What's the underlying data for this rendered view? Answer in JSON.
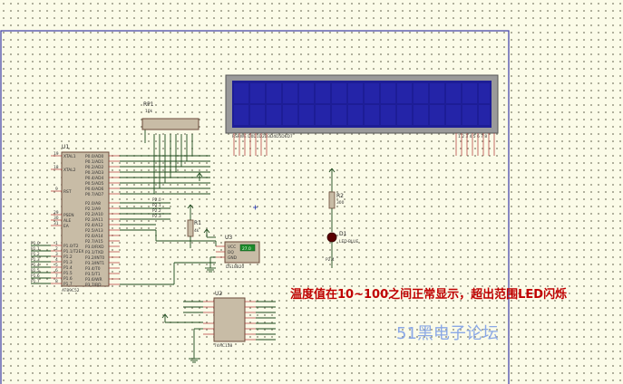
{
  "annotation": "温度值在10~100之间正常显示，超出范围LED闪烁",
  "watermark": "51黑电子论坛",
  "components": {
    "mcu": {
      "ref": "U1",
      "part": "AT89C52",
      "left_pins": [
        "XTAL1",
        "XTAL2",
        "RST",
        "PSEN",
        "ALE",
        "EA",
        "P1.0/T2",
        "P1.1/T2EX",
        "P1.2",
        "P1.3",
        "P1.4",
        "P1.5",
        "P1.6",
        "P1.7"
      ],
      "right_pins": [
        "P0.0/AD0",
        "P0.1/AD1",
        "P0.2/AD2",
        "P0.3/AD3",
        "P0.4/AD4",
        "P0.5/AD5",
        "P0.6/AD6",
        "P0.7/AD7",
        "P2.0/A8",
        "P2.1/A9",
        "P2.2/A10",
        "P2.3/A11",
        "P2.4/A12",
        "P2.5/A13",
        "P2.6/A14",
        "P2.7/A15",
        "P3.0/RXD",
        "P3.1/TXD",
        "P3.2/INT0",
        "P3.3/INT1",
        "P3.4/T0",
        "P3.5/T1",
        "P3.6/WR",
        "P3.7/RD"
      ],
      "left_pin_numbers": [
        "19",
        "18",
        "9",
        "29",
        "30",
        "31",
        "1",
        "2",
        "3",
        "4",
        "5",
        "6",
        "7",
        "8"
      ]
    },
    "rp1": {
      "ref": "RP1",
      "value": "10k"
    },
    "lcd": {
      "pins_left": "RSRWE D0D1D2D3D4D5D6D7",
      "pins_right": "1 2 3 4 5 6 7 8"
    },
    "r1": {
      "ref": "R1",
      "value": "4k"
    },
    "r2": {
      "ref": "R2",
      "value": "300"
    },
    "d1": {
      "ref": "D1",
      "part": "LED-BLUE",
      "net": "P2.4"
    },
    "u3": {
      "ref": "U3",
      "part": "DS18B20",
      "pins": [
        "VCC",
        "DQ",
        "GND"
      ],
      "display": "27.0"
    },
    "u2": {
      "ref": "U2",
      "part": "74HC138"
    },
    "net_labels": [
      "P1.0",
      "P1.1",
      "P1.2",
      "P1.3",
      "P1.4",
      "P1.5",
      "P1.6",
      "P1.7",
      "P2.0",
      "P2.1",
      "P2.2",
      "P2.3"
    ]
  },
  "colors": {
    "background": "#fbfbe8",
    "frame": "#3b3ba8",
    "lcd_screen": "#1d1d96",
    "annotation": "#c00000",
    "watermark": "#7fa0e6"
  }
}
